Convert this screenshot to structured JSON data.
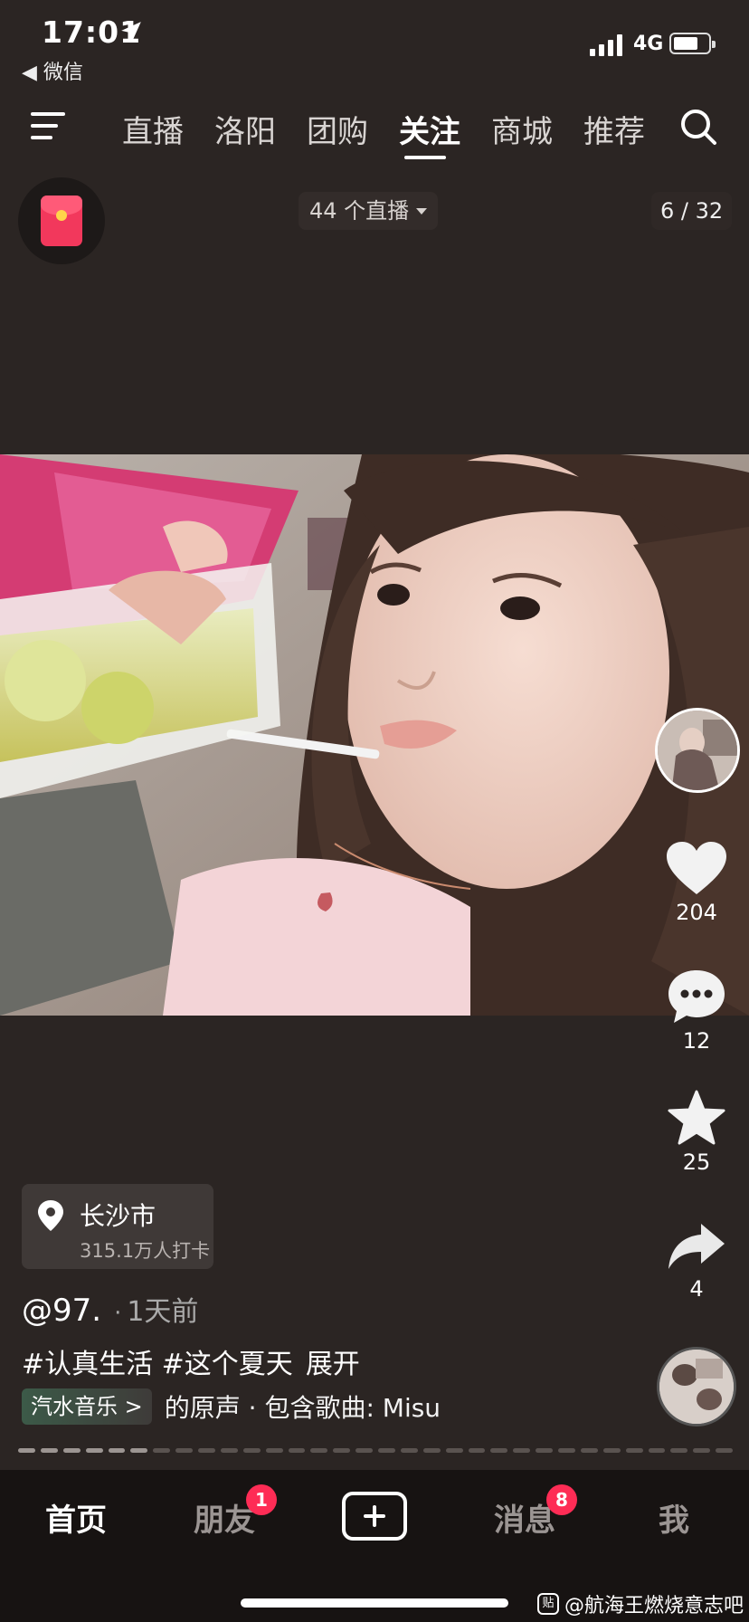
{
  "status_bar": {
    "time": "17:01",
    "back_label": "◀ 微信",
    "network": "4G"
  },
  "top_nav": {
    "tabs": [
      "直播",
      "洛阳",
      "团购",
      "关注",
      "商城",
      "推荐"
    ],
    "active_tab": "关注"
  },
  "live_count_label": "44 个直播",
  "page_indicator": "6 / 32",
  "actions": {
    "like_count": "204",
    "comment_count": "12",
    "favorite_count": "25",
    "share_count": "4"
  },
  "location": {
    "city": "长沙市",
    "checkins": "315.1万人打卡"
  },
  "post": {
    "author": "@97.",
    "separator": "·",
    "time_ago": "1天前",
    "hashtags": "#认真生活 #这个夏天",
    "expand_label": "展开",
    "music_tag": "汽水音乐 >",
    "music_title": "的原声 · 包含歌曲: Misu"
  },
  "progress": {
    "segments": 32,
    "current": 6
  },
  "bottom_nav": {
    "home": "首页",
    "friends": "朋友",
    "friends_badge": "1",
    "messages": "消息",
    "messages_badge": "8",
    "me": "我"
  },
  "watermark": {
    "icon_text": "贴",
    "text": "@航海王燃烧意志吧"
  },
  "colors": {
    "background": "#2b2523",
    "accent": "#fe2c55",
    "bottom_bar": "#171312"
  }
}
